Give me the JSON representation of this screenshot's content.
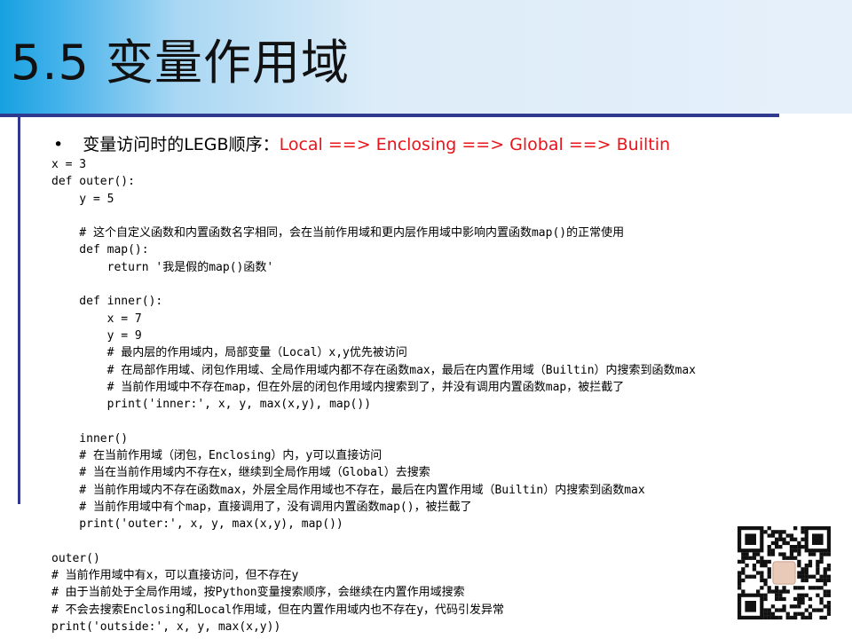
{
  "slide": {
    "title": "5.5 变量作用域",
    "bullet": {
      "lead": "变量访问时的LEGB顺序：",
      "highlight": "Local ==> Enclosing ==> Global ==> Builtin"
    },
    "code_lines": [
      "x = 3",
      "def outer():",
      "    y = 5",
      "",
      "    # 这个自定义函数和内置函数名字相同，会在当前作用域和更内层作用域中影响内置函数map()的正常使用",
      "    def map():",
      "        return '我是假的map()函数'",
      "",
      "    def inner():",
      "        x = 7",
      "        y = 9",
      "        # 最内层的作用域内，局部变量（Local）x,y优先被访问",
      "        # 在局部作用域、闭包作用域、全局作用域内都不存在函数max，最后在内置作用域（Builtin）内搜索到函数max",
      "        # 当前作用域中不存在map，但在外层的闭包作用域内搜索到了，并没有调用内置函数map，被拦截了",
      "        print('inner:', x, y, max(x,y), map())",
      "",
      "    inner()",
      "    # 在当前作用域（闭包，Enclosing）内，y可以直接访问",
      "    # 当在当前作用域内不存在x，继续到全局作用域（Global）去搜索",
      "    # 当前作用域内不存在函数max，外层全局作用域也不存在，最后在内置作用域（Builtin）内搜索到函数max",
      "    # 当前作用域中有个map，直接调用了，没有调用内置函数map()，被拦截了",
      "    print('outer:', x, y, max(x,y), map())",
      "",
      "outer()",
      "# 当前作用域中有x，可以直接访问，但不存在y",
      "# 由于当前处于全局作用域，按Python变量搜索顺序，会继续在内置作用域搜索",
      "# 不会去搜索Enclosing和Local作用域，但在内置作用域内也不存在y，代码引发异常",
      "print('outside:', x, y, max(x,y))"
    ],
    "colors": {
      "title_band_start": "#17a0e0",
      "title_band_end": "#e6f0fa",
      "rule": "#2f3a8f",
      "highlight": "#e8141a"
    },
    "qr_icon": "qr-code-icon"
  }
}
